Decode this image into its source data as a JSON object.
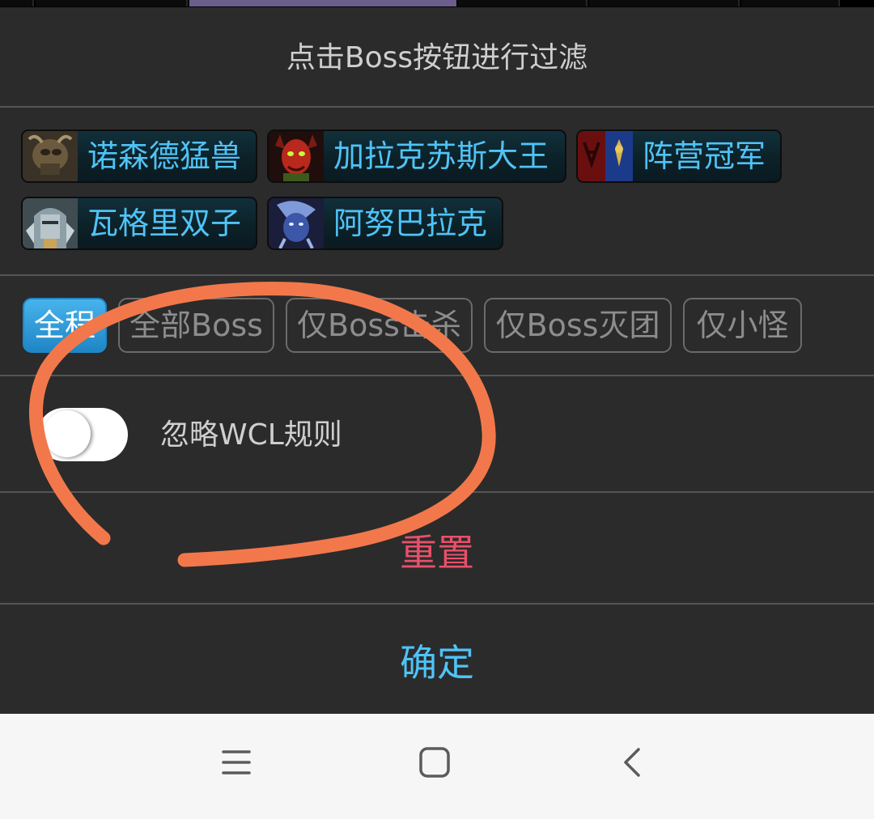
{
  "header": {
    "title": "点击Boss按钮进行过滤"
  },
  "bosses": [
    {
      "name": "诺森德猛兽",
      "icon": "northrend-beasts-portrait-icon"
    },
    {
      "name": "加拉克苏斯大王",
      "icon": "lord-jaraxxus-portrait-icon"
    },
    {
      "name": "阵营冠军",
      "icon": "faction-champions-portrait-icon"
    },
    {
      "name": "瓦格里双子",
      "icon": "valkyr-twins-portrait-icon"
    },
    {
      "name": "阿努巴拉克",
      "icon": "anubarak-portrait-icon"
    }
  ],
  "filters": [
    {
      "label": "全程",
      "selected": true
    },
    {
      "label": "全部Boss",
      "selected": false
    },
    {
      "label": "仅Boss击杀",
      "selected": false
    },
    {
      "label": "仅Boss灭团",
      "selected": false
    },
    {
      "label": "仅小怪",
      "selected": false
    }
  ],
  "toggle": {
    "label": "忽略WCL规则",
    "on": false
  },
  "actions": {
    "reset": "重置",
    "confirm": "确定"
  },
  "colors": {
    "background": "#2b2b2b",
    "boss_text": "#4fc3f7",
    "reset": "#e8506a",
    "confirm": "#4fc3f7",
    "selected_chip": "#2a97d6",
    "annotation": "#f2784b"
  },
  "navbar": {
    "icons": [
      "menu-icon",
      "home-icon",
      "back-icon"
    ]
  }
}
